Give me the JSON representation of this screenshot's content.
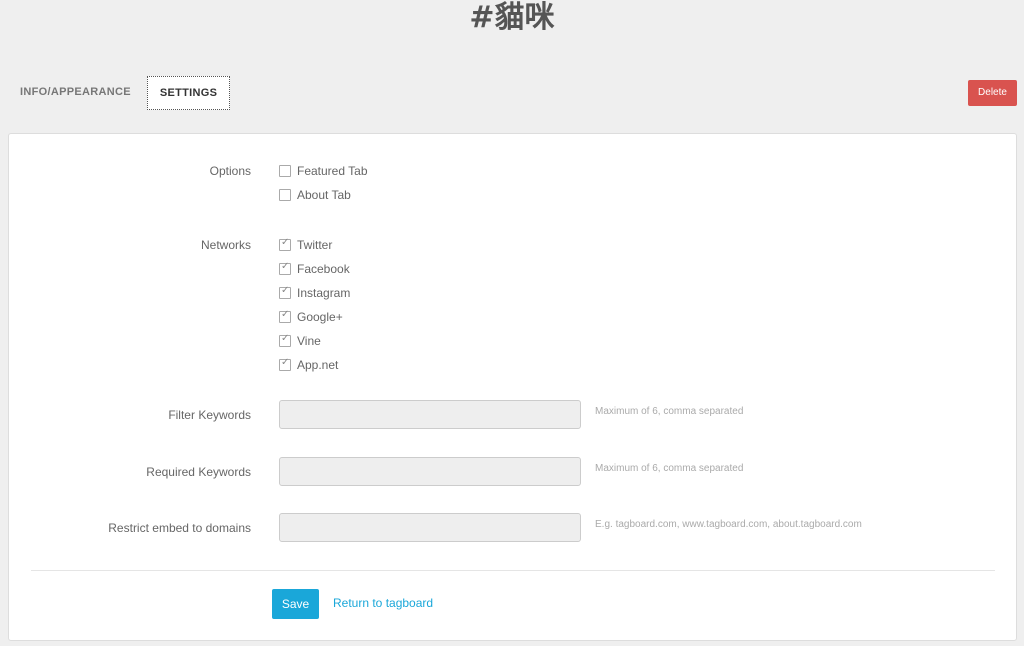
{
  "page": {
    "title": "#貓咪"
  },
  "tabs": [
    {
      "label": "INFO/APPEARANCE"
    },
    {
      "label": "SETTINGS"
    }
  ],
  "actions": {
    "delete_label": "Delete"
  },
  "form": {
    "options": {
      "label": "Options",
      "items": [
        {
          "label": "Featured Tab",
          "checked": false
        },
        {
          "label": "About Tab",
          "checked": false
        }
      ]
    },
    "networks": {
      "label": "Networks",
      "items": [
        {
          "label": "Twitter",
          "checked": true
        },
        {
          "label": "Facebook",
          "checked": true
        },
        {
          "label": "Instagram",
          "checked": true
        },
        {
          "label": "Google+",
          "checked": true
        },
        {
          "label": "Vine",
          "checked": true
        },
        {
          "label": "App.net",
          "checked": true
        }
      ]
    },
    "filter_keywords": {
      "label": "Filter Keywords",
      "value": "",
      "hint": "Maximum of 6, comma separated"
    },
    "required_keywords": {
      "label": "Required Keywords",
      "value": "",
      "hint": "Maximum of 6, comma separated"
    },
    "restrict_domains": {
      "label": "Restrict embed to domains",
      "value": "",
      "hint": "E.g. tagboard.com, www.tagboard.com, about.tagboard.com"
    }
  },
  "footer": {
    "save_label": "Save",
    "return_label": "Return to tagboard"
  },
  "colors": {
    "accent": "#1aa7d9",
    "danger": "#d9534f"
  }
}
